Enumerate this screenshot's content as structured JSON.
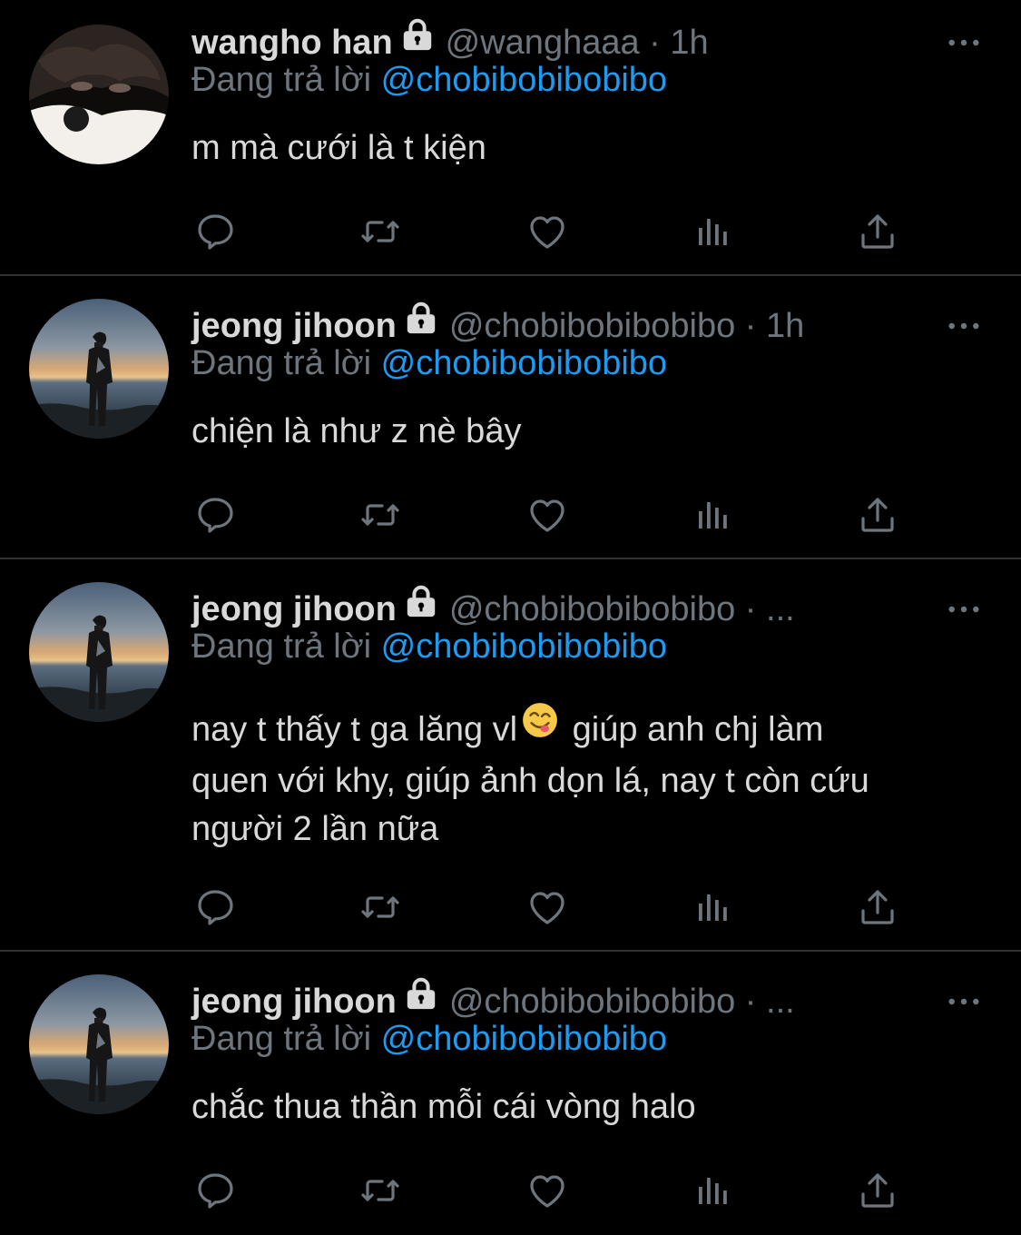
{
  "tweets": [
    {
      "name": "wangho han",
      "handle": "@wanghaaa",
      "dot": " · ",
      "time": "1h",
      "reply_prefix": "Đang trả lời ",
      "reply_to": "@chobibobibobibo",
      "text_lines": [
        "m mà cưới là t kiện"
      ]
    },
    {
      "name": "jeong jihoon",
      "handle": "@chobibobibobibo",
      "dot": " · ",
      "time": "1h",
      "reply_prefix": "Đang trả lời ",
      "reply_to": "@chobibobibobibo",
      "text_lines": [
        "chiện là như z nè bây"
      ]
    },
    {
      "name": "jeong jihoon",
      "handle": "@chobibobibobibo",
      "dot": " · ",
      "time": "...",
      "reply_prefix": "Đang trả lời ",
      "reply_to": "@chobibobibobibo",
      "text_part1": "nay t thấy t ga lăng vl",
      "text_part2": " giúp anh chj làm",
      "text_lines": [
        "quen với khy, giúp ảnh dọn lá, nay t còn cứu",
        "người 2 lần nữa"
      ]
    },
    {
      "name": "jeong jihoon",
      "handle": "@chobibobibobibo",
      "dot": " · ",
      "time": "...",
      "reply_prefix": "Đang trả lời ",
      "reply_to": "@chobibobibobibo",
      "text_lines": [
        "chắc thua thần mỗi cái vòng halo"
      ]
    }
  ],
  "icons": {
    "reply": "reply-icon",
    "retweet": "retweet-icon",
    "like": "heart-icon",
    "analytics": "analytics-icon",
    "share": "share-icon",
    "more": "more-icon",
    "lock": "lock-icon",
    "emoji": "yum-emoji"
  },
  "colors": {
    "background": "#000000",
    "text": "#d9d9d9",
    "secondary": "#6e767d",
    "accent": "#1d9bf0",
    "divider": "#2f3336"
  }
}
